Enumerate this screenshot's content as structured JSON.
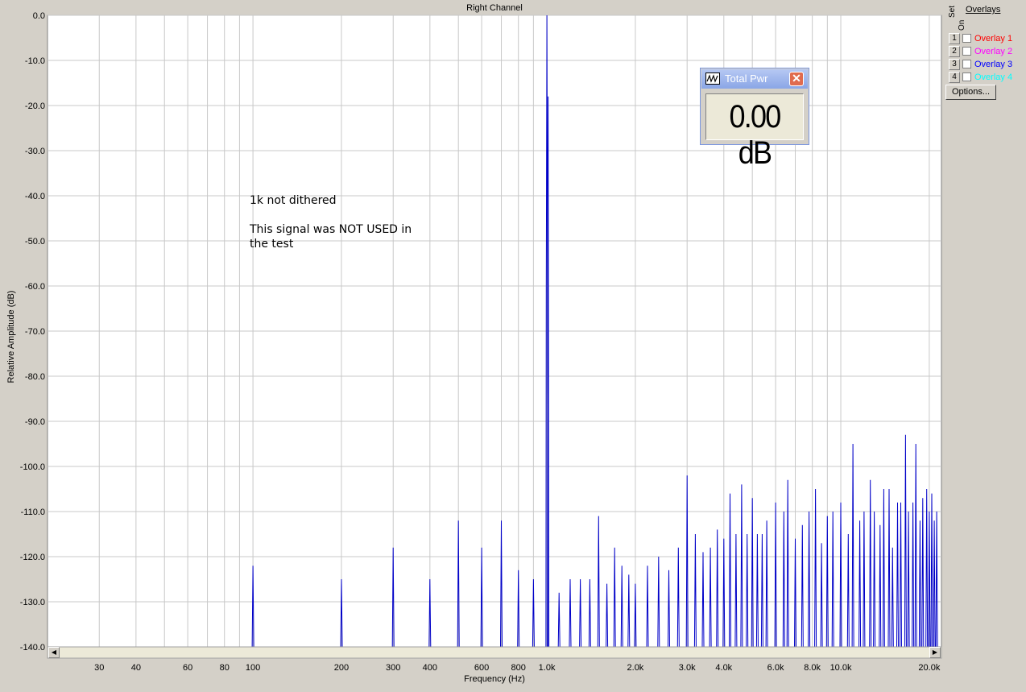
{
  "chart_data": {
    "type": "line",
    "title": "Right Channel",
    "xlabel": "Frequency (Hz)",
    "ylabel": "Relative Amplitude (dB)",
    "x_scale": "log",
    "xlim": [
      20,
      22000
    ],
    "ylim": [
      -140,
      0
    ],
    "grid": true,
    "ytick_labels": [
      "0.0",
      "-10.0",
      "-20.0",
      "-30.0",
      "-40.0",
      "-50.0",
      "-60.0",
      "-70.0",
      "-80.0",
      "-90.0",
      "-100.0",
      "-110.0",
      "-120.0",
      "-130.0",
      "-140.0"
    ],
    "xtick_labels": [
      {
        "f": 30,
        "label": "30"
      },
      {
        "f": 40,
        "label": "40"
      },
      {
        "f": 60,
        "label": "60"
      },
      {
        "f": 80,
        "label": "80"
      },
      {
        "f": 100,
        "label": "100"
      },
      {
        "f": 200,
        "label": "200"
      },
      {
        "f": 300,
        "label": "300"
      },
      {
        "f": 400,
        "label": "400"
      },
      {
        "f": 600,
        "label": "600"
      },
      {
        "f": 800,
        "label": "800"
      },
      {
        "f": 1000,
        "label": "1.0k"
      },
      {
        "f": 2000,
        "label": "2.0k"
      },
      {
        "f": 3000,
        "label": "3.0k"
      },
      {
        "f": 4000,
        "label": "4.0k"
      },
      {
        "f": 6000,
        "label": "6.0k"
      },
      {
        "f": 8000,
        "label": "8.0k"
      },
      {
        "f": 10000,
        "label": "10.0k"
      },
      {
        "f": 20000,
        "label": "20.0k"
      }
    ],
    "series": [
      {
        "color": "#0000c8",
        "floor": -140,
        "peaks": [
          [
            100,
            -122
          ],
          [
            200,
            -125
          ],
          [
            300,
            -118
          ],
          [
            400,
            -125
          ],
          [
            500,
            -112
          ],
          [
            600,
            -118
          ],
          [
            700,
            -112
          ],
          [
            800,
            -123
          ],
          [
            900,
            -125
          ],
          [
            1000,
            0
          ],
          [
            1010,
            -18
          ],
          [
            1100,
            -128
          ],
          [
            1200,
            -125
          ],
          [
            1300,
            -125
          ],
          [
            1400,
            -125
          ],
          [
            1500,
            -111
          ],
          [
            1600,
            -126
          ],
          [
            1700,
            -118
          ],
          [
            1800,
            -122
          ],
          [
            1900,
            -124
          ],
          [
            2000,
            -126
          ],
          [
            2200,
            -122
          ],
          [
            2400,
            -120
          ],
          [
            2600,
            -123
          ],
          [
            2800,
            -118
          ],
          [
            3000,
            -102
          ],
          [
            3200,
            -115
          ],
          [
            3400,
            -119
          ],
          [
            3600,
            -118
          ],
          [
            3800,
            -114
          ],
          [
            4000,
            -116
          ],
          [
            4200,
            -106
          ],
          [
            4400,
            -115
          ],
          [
            4600,
            -104
          ],
          [
            4800,
            -115
          ],
          [
            5000,
            -107
          ],
          [
            5200,
            -115
          ],
          [
            5400,
            -115
          ],
          [
            5600,
            -112
          ],
          [
            6000,
            -108
          ],
          [
            6400,
            -110
          ],
          [
            6600,
            -103
          ],
          [
            7000,
            -116
          ],
          [
            7400,
            -113
          ],
          [
            7800,
            -110
          ],
          [
            8200,
            -105
          ],
          [
            8600,
            -117
          ],
          [
            9000,
            -111
          ],
          [
            9400,
            -110
          ],
          [
            10000,
            -108
          ],
          [
            10600,
            -115
          ],
          [
            11000,
            -95
          ],
          [
            11600,
            -112
          ],
          [
            12000,
            -110
          ],
          [
            12600,
            -103
          ],
          [
            13000,
            -110
          ],
          [
            13600,
            -113
          ],
          [
            14000,
            -105
          ],
          [
            14600,
            -105
          ],
          [
            15000,
            -118
          ],
          [
            15600,
            -108
          ],
          [
            16000,
            -108
          ],
          [
            16600,
            -93
          ],
          [
            17000,
            -110
          ],
          [
            17600,
            -108
          ],
          [
            18000,
            -95
          ],
          [
            18600,
            -112
          ],
          [
            19000,
            -107
          ],
          [
            19600,
            -105
          ],
          [
            20000,
            -110
          ],
          [
            20400,
            -106
          ],
          [
            20800,
            -112
          ],
          [
            21200,
            -110
          ]
        ]
      }
    ],
    "annotations": [
      "1k not dithered",
      "This signal was NOT USED in",
      "the test"
    ]
  },
  "overlays": {
    "title": "Overlays",
    "set_header": "Set",
    "on_header": "On",
    "items": [
      {
        "num": "1",
        "label": "Overlay 1",
        "color": "#ff0000"
      },
      {
        "num": "2",
        "label": "Overlay 2",
        "color": "#ff00ff"
      },
      {
        "num": "3",
        "label": "Overlay 3",
        "color": "#0000ff"
      },
      {
        "num": "4",
        "label": "Overlay 4",
        "color": "#00ffff"
      }
    ],
    "options_label": "Options..."
  },
  "total_power": {
    "title": "Total Pwr",
    "value": "0.00 dB"
  }
}
